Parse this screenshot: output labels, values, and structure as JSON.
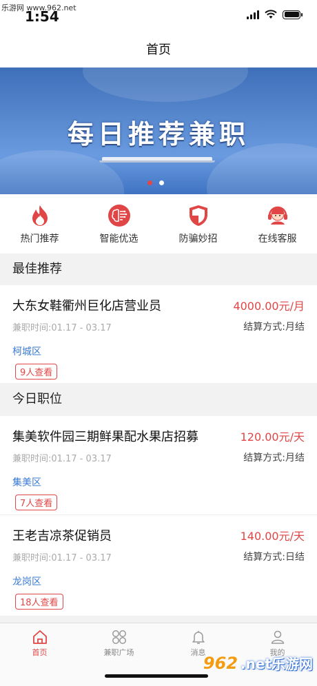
{
  "watermark": {
    "top": "乐游网 www.962.net",
    "bottom_number": "962",
    "bottom_text": ".net乐游网"
  },
  "status_bar": {
    "time": "1:54"
  },
  "nav": {
    "title": "首页"
  },
  "banner": {
    "text": "每日推荐兼职",
    "dots": [
      true,
      false
    ],
    "active_color": "#e04646"
  },
  "quick_links": [
    {
      "label": "热门推荐",
      "icon": "flame-icon"
    },
    {
      "label": "智能优选",
      "icon": "brain-chip-icon"
    },
    {
      "label": "防骗妙招",
      "icon": "shield-icon"
    },
    {
      "label": "在线客服",
      "icon": "headset-icon"
    }
  ],
  "sections": {
    "best": {
      "title": "最佳推荐",
      "jobs": [
        {
          "title": "大东女鞋衢州巨化店营业员",
          "pay": "4000.00元/月",
          "time": "兼职时间:01.17 - 03.17",
          "settle": "结算方式:月结",
          "area": "柯城区",
          "views": "9人查看"
        }
      ]
    },
    "today": {
      "title": "今日职位",
      "jobs": [
        {
          "title": "集美软件园三期鲜果配水果店招募",
          "pay": "120.00元/天",
          "time": "兼职时间:01.17 - 03.17",
          "settle": "结算方式:月结",
          "area": "集美区",
          "views": "7人查看"
        },
        {
          "title": "王老吉凉茶促销员",
          "pay": "140.00元/天",
          "time": "兼职时间:01.17 - 03.17",
          "settle": "结算方式:日结",
          "area": "龙岗区",
          "views": "18人查看"
        }
      ]
    }
  },
  "tabbar": [
    {
      "label": "首页",
      "icon": "home-icon",
      "active": true
    },
    {
      "label": "兼职广场",
      "icon": "grid-circles-icon",
      "active": false
    },
    {
      "label": "消息",
      "icon": "bell-icon",
      "active": false
    },
    {
      "label": "我的",
      "icon": "user-icon",
      "active": false
    }
  ],
  "colors": {
    "accent": "#e04646",
    "link": "#3a7bd5",
    "banner": "#4a7cc6"
  }
}
